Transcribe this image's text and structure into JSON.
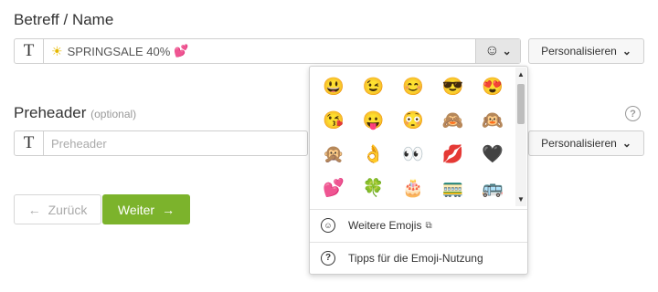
{
  "subject": {
    "label": "Betreff / Name",
    "type_icon": "T",
    "value_prefix_icon": "☀",
    "value": "SPRINGSALE 40%",
    "value_suffix_icon": "💕",
    "emoji_button_icon": "☺",
    "emoji_button_chevron": "⌄",
    "personalize_label": "Personalisieren",
    "personalize_chevron": "⌄"
  },
  "preheader": {
    "label": "Preheader",
    "optional_label": "(optional)",
    "type_icon": "T",
    "placeholder": "Preheader",
    "personalize_label": "Personalisieren",
    "personalize_chevron": "⌄",
    "help_icon": "?"
  },
  "nav": {
    "back_label": "Zurück",
    "back_icon": "←",
    "next_label": "Weiter",
    "next_icon": "→"
  },
  "emoji_popup": {
    "emojis": [
      "😃",
      "😉",
      "😊",
      "😎",
      "😍",
      "😘",
      "😛",
      "😳",
      "🙈",
      "🙉",
      "🙊",
      "👌",
      "👀",
      "💋",
      "🖤",
      "💕",
      "🍀",
      "🎂",
      "🚃",
      "🚌"
    ],
    "scroll_up_icon": "▲",
    "scroll_down_icon": "▼",
    "more_emojis_label": "Weitere Emojis",
    "more_emojis_icon": "☺",
    "external_link_icon": "⧉",
    "tips_label": "Tipps für die Emoji-Nutzung",
    "tips_icon": "?"
  },
  "colors": {
    "accent_green": "#7cb32c",
    "border": "#cfcfcf"
  }
}
